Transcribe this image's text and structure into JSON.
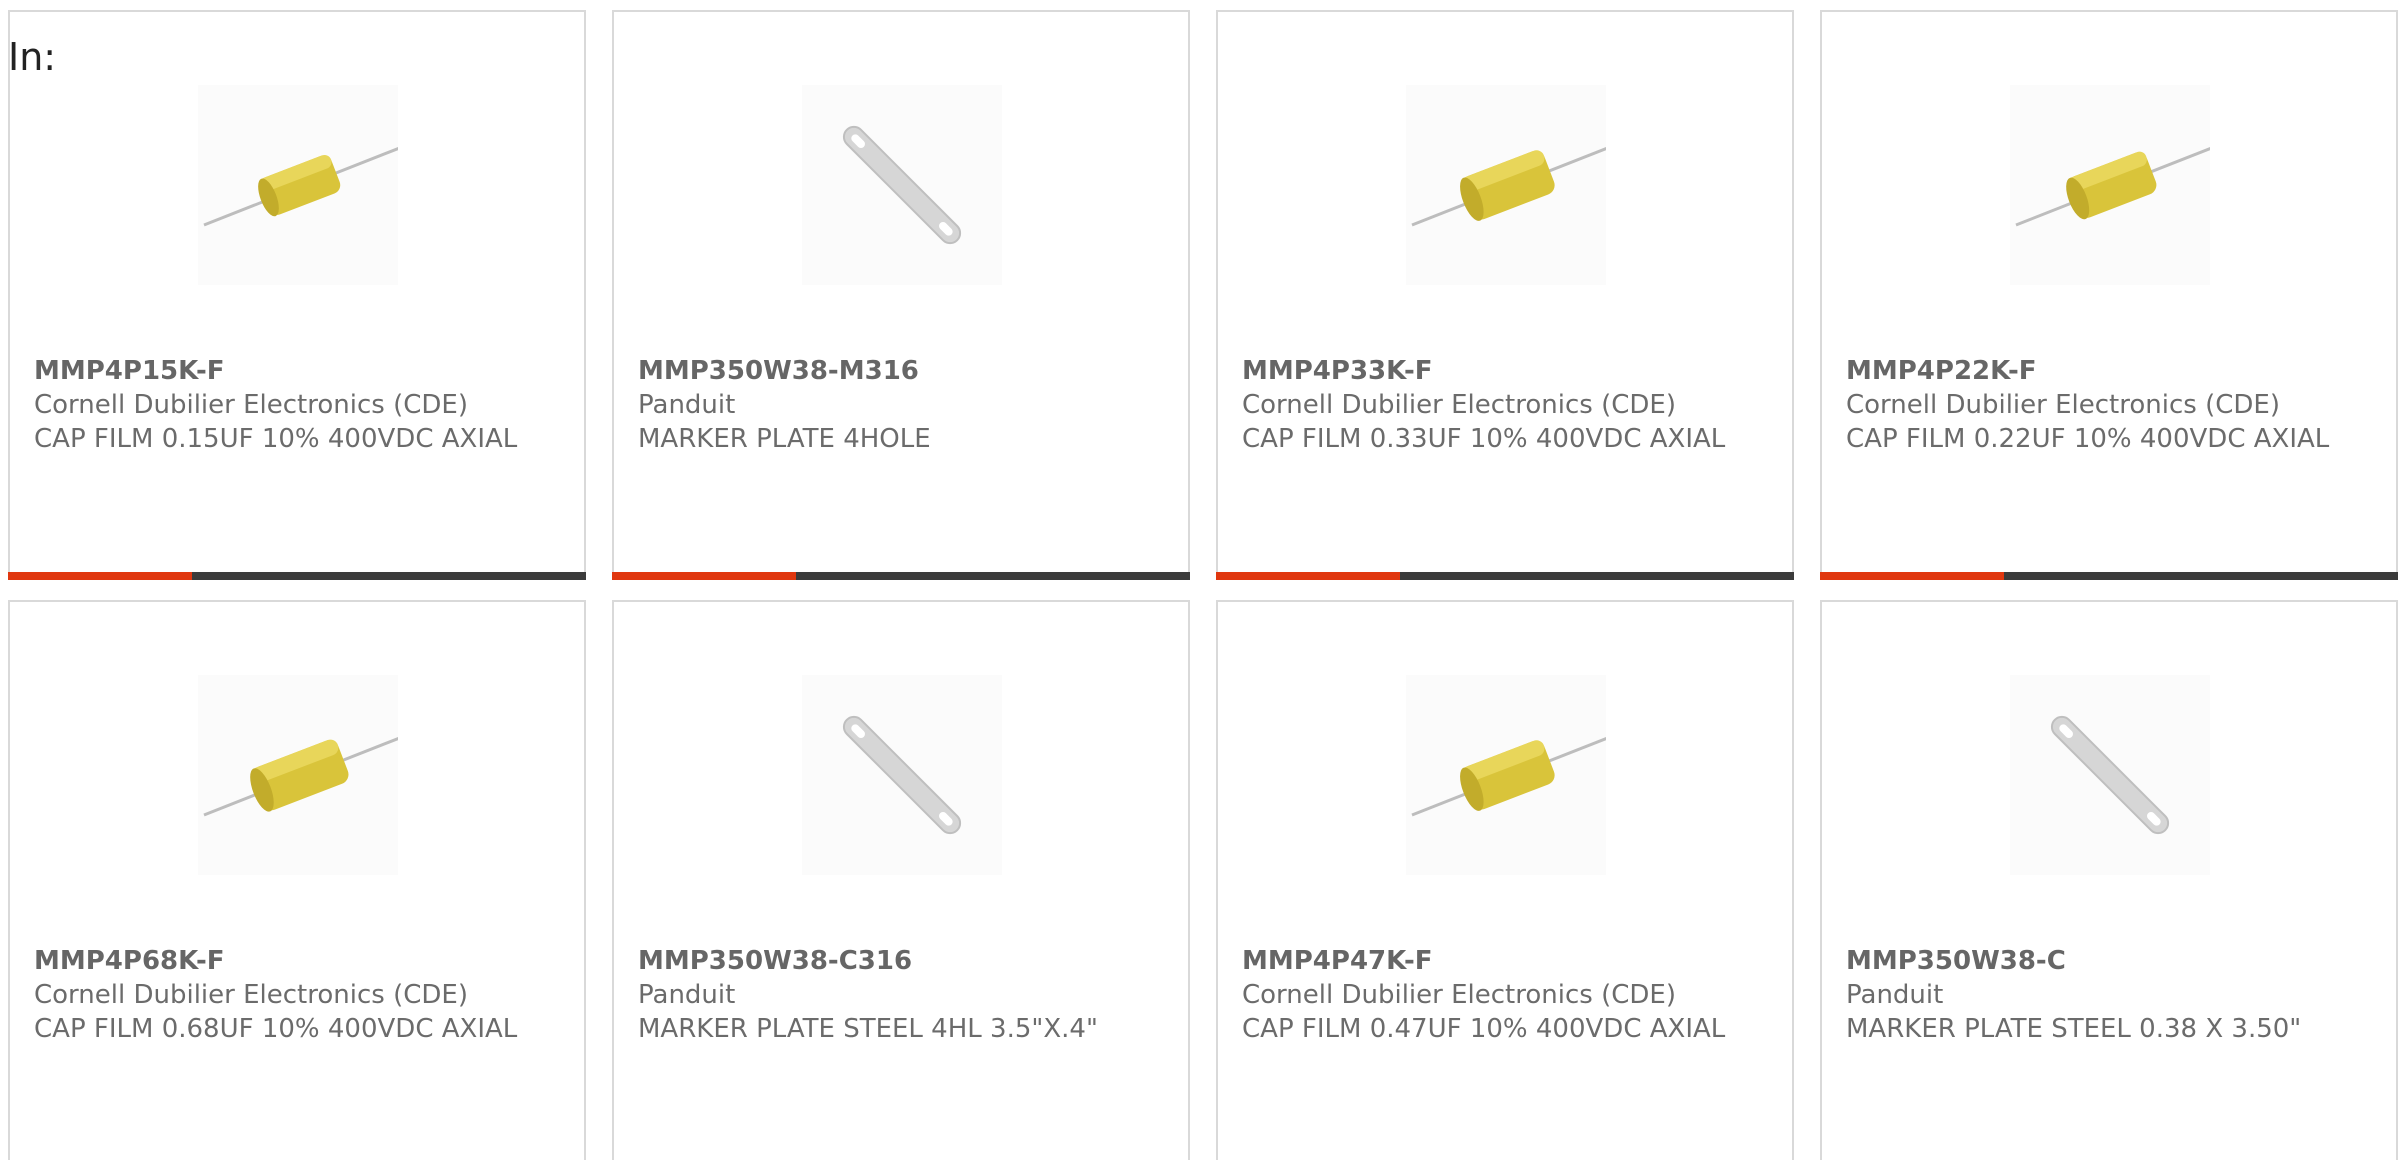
{
  "filter_label": "In:",
  "colors": {
    "bar_accent": "#e0370f",
    "bar_base": "#3b3b3b",
    "card_border": "#d9d9d9",
    "text": "#6b6b6b"
  },
  "products": [
    {
      "part_number": "MMP4P15K-F",
      "manufacturer": "Cornell Dubilier Electronics (CDE)",
      "description": "CAP FILM 0.15UF 10% 400VDC AXIAL",
      "image": "capacitor-image"
    },
    {
      "part_number": "MMP350W38-M316",
      "manufacturer": "Panduit",
      "description": "MARKER PLATE 4HOLE",
      "image": "marker-plate-image"
    },
    {
      "part_number": "MMP4P33K-F",
      "manufacturer": "Cornell Dubilier Electronics (CDE)",
      "description": "CAP FILM 0.33UF 10% 400VDC AXIAL",
      "image": "capacitor-image"
    },
    {
      "part_number": "MMP4P22K-F",
      "manufacturer": "Cornell Dubilier Electronics (CDE)",
      "description": "CAP FILM 0.22UF 10% 400VDC AXIAL",
      "image": "capacitor-image"
    },
    {
      "part_number": "MMP4P68K-F",
      "manufacturer": "Cornell Dubilier Electronics (CDE)",
      "description": "CAP FILM 0.68UF 10% 400VDC AXIAL",
      "image": "capacitor-image"
    },
    {
      "part_number": "MMP350W38-C316",
      "manufacturer": "Panduit",
      "description": "MARKER PLATE STEEL 4HL 3.5\"X.4\"",
      "image": "marker-plate-image"
    },
    {
      "part_number": "MMP4P47K-F",
      "manufacturer": "Cornell Dubilier Electronics (CDE)",
      "description": "CAP FILM 0.47UF 10% 400VDC AXIAL",
      "image": "capacitor-image"
    },
    {
      "part_number": "MMP350W38-C",
      "manufacturer": "Panduit",
      "description": "MARKER PLATE STEEL 0.38 X 3.50\"",
      "image": "marker-plate-image"
    }
  ]
}
